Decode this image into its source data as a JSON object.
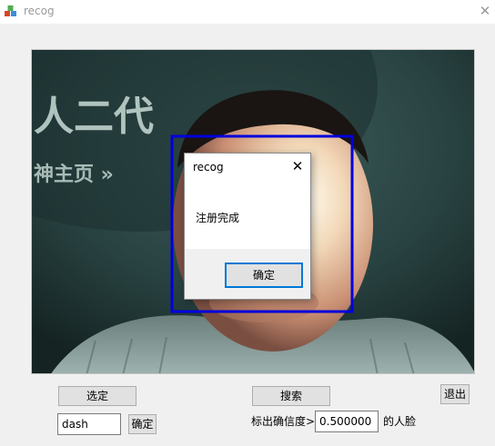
{
  "window": {
    "title": "recog",
    "close_glyph": "✕"
  },
  "camera": {
    "overlay_text_line1": "人二代",
    "overlay_text_line2": "神主页 »",
    "face_box_color": "#0000dd"
  },
  "controls": {
    "select_label": "选定",
    "search_label": "搜索",
    "exit_label": "退出",
    "name_value": "dash",
    "confirm_label": "确定",
    "threshold_prefix": "标出确信度>",
    "threshold_value": "0.500000",
    "threshold_suffix": "的人脸"
  },
  "dialog": {
    "title": "recog",
    "close_glyph": "✕",
    "message": "注册完成",
    "ok_label": "确定"
  },
  "colors": {
    "accent": "#0078d7"
  }
}
